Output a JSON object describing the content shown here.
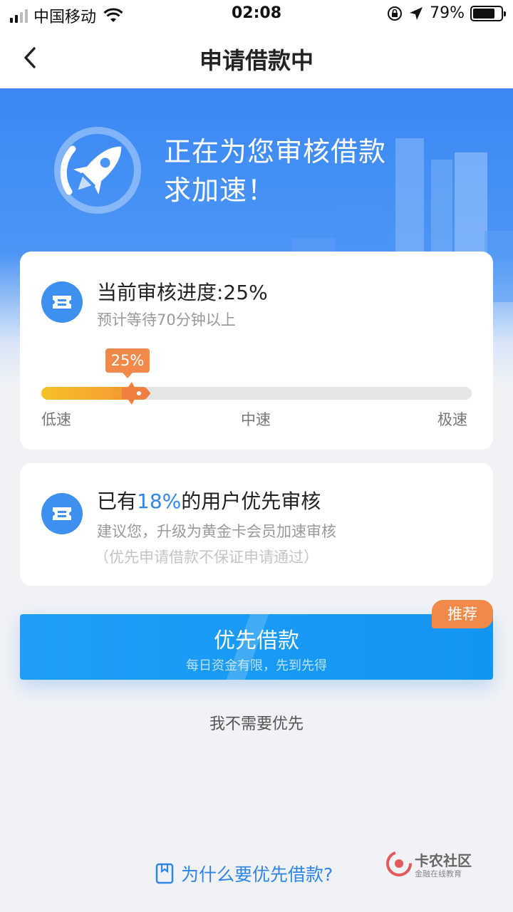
{
  "status_bar": {
    "carrier": "中国移动",
    "time": "02:08",
    "battery_percent": "79%",
    "battery_level": 0.79,
    "icons": [
      "signal-icon",
      "wifi-icon",
      "rotation-lock-icon",
      "location-icon",
      "battery-icon"
    ]
  },
  "nav": {
    "back_icon": "chevron-left-icon",
    "title": "申请借款中"
  },
  "hero": {
    "line1": "正在为您审核借款",
    "line2": "求加速！",
    "icon": "rocket-icon"
  },
  "progress_card": {
    "icon": "ticket-icon",
    "title": "当前审核进度:25%",
    "subtitle": "预计等待70分钟以上",
    "badge": "25%",
    "progress": 0.25,
    "scale_low": "低速",
    "scale_mid": "中速",
    "scale_high": "极速"
  },
  "users_card": {
    "icon": "ticket-icon",
    "title_prefix": "已有",
    "title_highlight": "18%",
    "title_suffix": "的用户优先审核",
    "subtitle": "建议您，升级为黄金卡会员加速审核",
    "note": "（优先申请借款不保证申请通过）"
  },
  "cta": {
    "label": "优先借款",
    "sub": "每日资金有限，先到先得",
    "tag": "推荐"
  },
  "decline_label": "我不需要优先",
  "why_link": {
    "icon": "document-icon",
    "label": "为什么要优先借款?"
  },
  "watermark": {
    "title": "卡农社区",
    "sub": "金融在线教育"
  },
  "colors": {
    "primary_blue": "#1296f4",
    "accent_orange": "#f0894a",
    "link_blue": "#2f86ea"
  }
}
